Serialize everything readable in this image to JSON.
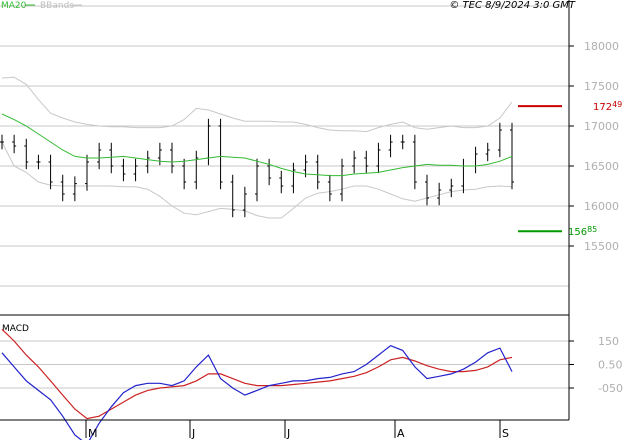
{
  "legend": {
    "ma_label": "MA20",
    "bbands_label": "BBands"
  },
  "credit": "© TEC 8/9/2024 3:0 GMT",
  "price_axis": {
    "ticks": [
      {
        "label": "18000",
        "value": 18000
      },
      {
        "label": "17500",
        "value": 17500
      },
      {
        "label": "17000",
        "value": 17000
      },
      {
        "label": "16500",
        "value": 16500
      },
      {
        "label": "16000",
        "value": 16000
      },
      {
        "label": "15500",
        "value": 15500
      }
    ]
  },
  "resistance": {
    "value": 17249,
    "label_main": "172",
    "label_sup": "49",
    "color": "#cc0000"
  },
  "support": {
    "value": 15685,
    "label_main": "156",
    "label_sup": "85",
    "color": "#009900"
  },
  "macd_panel": {
    "title": "MACD",
    "ticks": [
      {
        "label": "150",
        "value": 150
      },
      {
        "label": "0.50",
        "value": 50
      },
      {
        "label": "-050",
        "value": -50
      }
    ]
  },
  "months": [
    "M",
    "J",
    "J",
    "A",
    "S"
  ],
  "colors": {
    "ma": "#33bb33",
    "bbands": "#c8c8c8",
    "bars": "#000000",
    "macd": "#2222cc",
    "signal": "#cc2222",
    "grid": "#c8c8c8"
  },
  "chart_data": [
    {
      "type": "ohlc",
      "ylim": [
        15000,
        18500
      ],
      "series": [
        {
          "name": "MA20",
          "values": [
            17150,
            17080,
            17000,
            16900,
            16800,
            16700,
            16620,
            16600,
            16600,
            16610,
            16620,
            16600,
            16580,
            16560,
            16550,
            16560,
            16580,
            16600,
            16620,
            16610,
            16600,
            16560,
            16520,
            16470,
            16430,
            16400,
            16390,
            16380,
            16380,
            16400,
            16410,
            16420,
            16450,
            16480,
            16500,
            16520,
            16510,
            16510,
            16500,
            16500,
            16520,
            16560,
            16620
          ]
        },
        {
          "name": "BBands",
          "values": []
        }
      ],
      "bbands_upper": [
        17600,
        17610,
        17520,
        17330,
        17160,
        17100,
        17050,
        17020,
        17000,
        16990,
        16990,
        16980,
        16980,
        16980,
        17000,
        17080,
        17220,
        17200,
        17150,
        17100,
        17060,
        17060,
        17060,
        17050,
        17050,
        17020,
        16980,
        16950,
        16940,
        16940,
        16930,
        16980,
        17020,
        17050,
        16980,
        16960,
        16980,
        17000,
        16980,
        16980,
        17000,
        17100,
        17300
      ],
      "bbands_lower": [
        16800,
        16500,
        16420,
        16300,
        16260,
        16250,
        16250,
        16250,
        16250,
        16250,
        16240,
        16240,
        16210,
        16120,
        16000,
        15910,
        15890,
        15930,
        15970,
        15960,
        15940,
        15880,
        15850,
        15850,
        15970,
        16100,
        16160,
        16180,
        16210,
        16250,
        16250,
        16210,
        16150,
        16090,
        16060,
        16100,
        16140,
        16180,
        16200,
        16210,
        16240,
        16250,
        16240
      ],
      "price_close": [
        16800,
        16750,
        16550,
        16550,
        16300,
        16150,
        16280,
        16550,
        16700,
        16500,
        16400,
        16500,
        16600,
        16700,
        16500,
        16300,
        16600,
        17000,
        16300,
        15950,
        16150,
        16500,
        16350,
        16250,
        16450,
        16550,
        16300,
        16150,
        16500,
        16600,
        16500,
        16700,
        16800,
        16800,
        16300,
        16100,
        16200,
        16250,
        16500,
        16650,
        16700,
        16950,
        16300
      ]
    },
    {
      "type": "line",
      "title": "MACD",
      "ylim": [
        -120,
        230
      ],
      "series": [
        {
          "name": "MACD",
          "values": [
            100,
            40,
            -20,
            -60,
            -100,
            -170,
            -250,
            -290,
            -200,
            -130,
            -70,
            -40,
            -30,
            -30,
            -40,
            -20,
            40,
            90,
            -10,
            -50,
            -80,
            -60,
            -40,
            -30,
            -20,
            -20,
            -10,
            -5,
            10,
            20,
            50,
            90,
            130,
            110,
            40,
            -10,
            0,
            10,
            30,
            60,
            100,
            120,
            20
          ]
        },
        {
          "name": "Signal",
          "values": [
            200,
            150,
            90,
            40,
            -20,
            -80,
            -140,
            -180,
            -170,
            -140,
            -110,
            -80,
            -60,
            -50,
            -45,
            -40,
            -20,
            10,
            10,
            -10,
            -30,
            -40,
            -40,
            -40,
            -35,
            -30,
            -25,
            -20,
            -10,
            0,
            15,
            40,
            70,
            80,
            65,
            45,
            30,
            20,
            20,
            25,
            40,
            70,
            80
          ]
        }
      ]
    }
  ]
}
